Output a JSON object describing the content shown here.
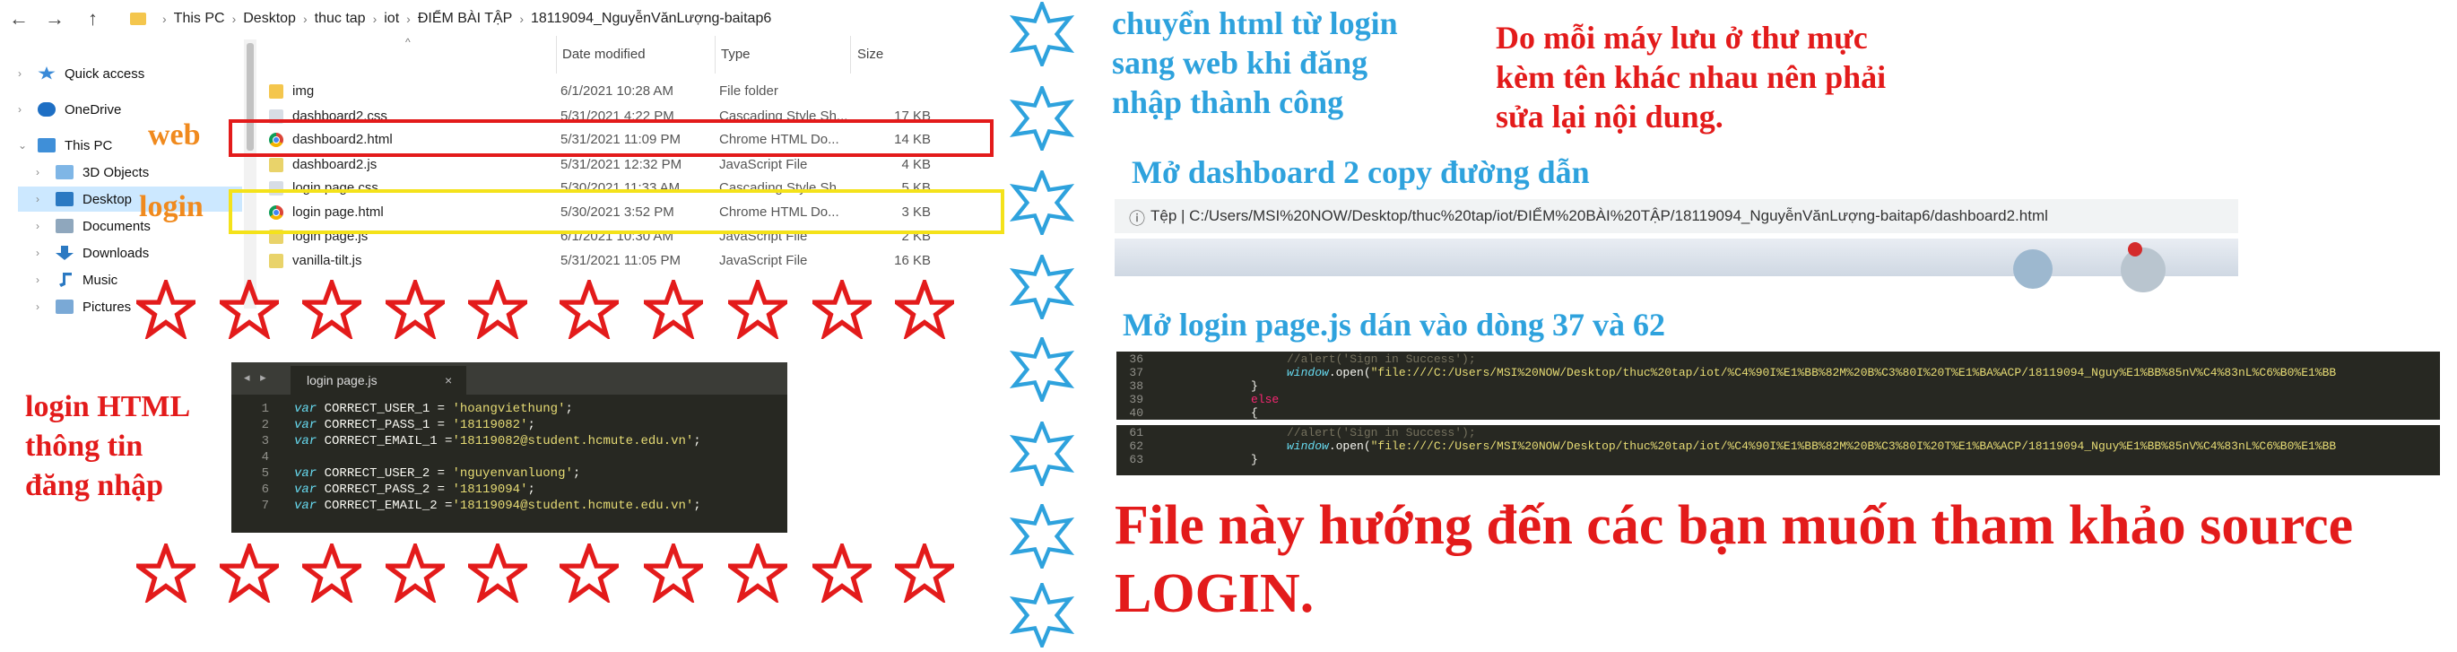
{
  "explorer": {
    "nav": {
      "back": "←",
      "forward": "→",
      "up": "↑"
    },
    "breadcrumb": [
      "This PC",
      "Desktop",
      "thuc tap",
      "iot",
      "ĐIỂM BÀI TẬP",
      "18119094_NguyễnVănLượng-baitap6"
    ],
    "columns": {
      "date": "Date modified",
      "type": "Type",
      "size": "Size"
    },
    "sidebar": [
      {
        "label": "Quick access",
        "icon": "star-icon"
      },
      {
        "label": "OneDrive",
        "icon": "cloud-icon"
      },
      {
        "label": "This PC",
        "icon": "computer-icon"
      },
      {
        "label": "3D Objects",
        "icon": "cube-icon"
      },
      {
        "label": "Desktop",
        "icon": "desktop-icon"
      },
      {
        "label": "Documents",
        "icon": "document-icon"
      },
      {
        "label": "Downloads",
        "icon": "download-icon"
      },
      {
        "label": "Music",
        "icon": "music-icon"
      },
      {
        "label": "Pictures",
        "icon": "picture-icon"
      }
    ],
    "files": [
      {
        "name": "img",
        "date": "6/1/2021 10:28 AM",
        "type": "File folder",
        "size": "",
        "icon": "folder-icon"
      },
      {
        "name": "dashboard2.css",
        "date": "5/31/2021 4:22 PM",
        "type": "Cascading Style Sh...",
        "size": "17 KB",
        "icon": "css-file-icon"
      },
      {
        "name": "dashboard2.html",
        "date": "5/31/2021 11:09 PM",
        "type": "Chrome HTML Do...",
        "size": "14 KB",
        "icon": "chrome-icon"
      },
      {
        "name": "dashboard2.js",
        "date": "5/31/2021 12:32 PM",
        "type": "JavaScript File",
        "size": "4 KB",
        "icon": "js-file-icon"
      },
      {
        "name": "login page.css",
        "date": "5/30/2021 11:33 AM",
        "type": "Cascading Style Sh...",
        "size": "5 KB",
        "icon": "css-file-icon"
      },
      {
        "name": "login page.html",
        "date": "5/30/2021 3:52 PM",
        "type": "Chrome HTML Do...",
        "size": "3 KB",
        "icon": "chrome-icon"
      },
      {
        "name": "login page.js",
        "date": "6/1/2021 10:30 AM",
        "type": "JavaScript File",
        "size": "2 KB",
        "icon": "js-file-icon"
      },
      {
        "name": "vanilla-tilt.js",
        "date": "5/31/2021 11:05 PM",
        "type": "JavaScript File",
        "size": "16 KB",
        "icon": "js-file-icon"
      }
    ]
  },
  "annotations": {
    "web_label": "web",
    "login_label": "login",
    "login_html_note": [
      "login HTML",
      "thông tin",
      "đăng nhập"
    ],
    "redirect_note": [
      "chuyển html từ login",
      "sang web khi đăng",
      "nhập thành công"
    ],
    "path_note": [
      "Do mỗi máy lưu ở thư mực",
      "kèm tên khác nhau nên phải",
      "sửa lại nội dung."
    ],
    "open_dashboard": "Mở dashboard 2 copy đường dẫn",
    "open_loginjs": "Mở login page.js dán vào dòng 37 và 62",
    "footer": [
      "File này hướng đến các bạn muốn tham khảo source",
      "LOGIN."
    ]
  },
  "code_editor": {
    "tab_label": "login page.js",
    "tab_nav": "◂ ▸",
    "tab_close": "×",
    "lines": [
      {
        "n": "1",
        "kw": "var",
        "rest": " CORRECT_USER_1 = ",
        "str": "'hoangviethung'",
        "end": ";"
      },
      {
        "n": "2",
        "kw": "var",
        "rest": " CORRECT_PASS_1 = ",
        "str": "'18119082'",
        "end": ";"
      },
      {
        "n": "3",
        "kw": "var",
        "rest": " CORRECT_EMAIL_1 =",
        "str": "'18119082@student.hcmute.edu.vn'",
        "end": ";"
      },
      {
        "n": "4",
        "kw": "",
        "rest": "",
        "str": "",
        "end": ""
      },
      {
        "n": "5",
        "kw": "var",
        "rest": " CORRECT_USER_2 = ",
        "str": "'nguyenvanluong'",
        "end": ";"
      },
      {
        "n": "6",
        "kw": "var",
        "rest": " CORRECT_PASS_2 = ",
        "str": "'18119094'",
        "end": ";"
      },
      {
        "n": "7",
        "kw": "var",
        "rest": " CORRECT_EMAIL_2 =",
        "str": "'18119094@student.hcmute.edu.vn'",
        "end": ";"
      }
    ]
  },
  "browser": {
    "info_icon": "ⓘ",
    "url": "Tệp  |  C:/Users/MSI%20NOW/Desktop/thuc%20tap/iot/ĐIỂM%20BÀI%20TẬP/18119094_NguyễnVănLượng-baitap6/dashboard2.html"
  },
  "snippet_a": [
    {
      "n": "36",
      "cmt": "//alert('Sign in Success');",
      "fn": "",
      "rest": ""
    },
    {
      "n": "37",
      "cmt": "",
      "fn": "window",
      "rest": ".open(\"file:///C:/Users/MSI%20NOW/Desktop/thuc%20tap/iot/%C4%90I%E1%BB%82M%20B%C3%80I%20T%E1%BA%ACP/18119094_Nguy%E1%BB%85nV%C4%83nL%C6%B0%E1%BB"
    },
    {
      "n": "38",
      "cmt": "",
      "fn": "",
      "rest": "}"
    },
    {
      "n": "39",
      "cmt": "",
      "fn": "",
      "rest": "else",
      "kw": true
    },
    {
      "n": "40",
      "cmt": "",
      "fn": "",
      "rest": "{"
    }
  ],
  "snippet_b": [
    {
      "n": "61",
      "cmt": "//alert('Sign in Success');",
      "fn": "",
      "rest": ""
    },
    {
      "n": "62",
      "cmt": "",
      "fn": "window",
      "rest": ".open(\"file:///C:/Users/MSI%20NOW/Desktop/thuc%20tap/iot/%C4%90I%E1%BB%82M%20B%C3%80I%20T%E1%BA%ACP/18119094_Nguy%E1%BB%85nV%C4%83nL%C6%B0%E1%BB"
    },
    {
      "n": "63",
      "cmt": "",
      "fn": "",
      "rest": "}"
    }
  ],
  "colors": {
    "red": "#e31b1b",
    "orange": "#f08a1e",
    "cyan": "#2ea2dd",
    "yellow": "#f4e21a"
  }
}
